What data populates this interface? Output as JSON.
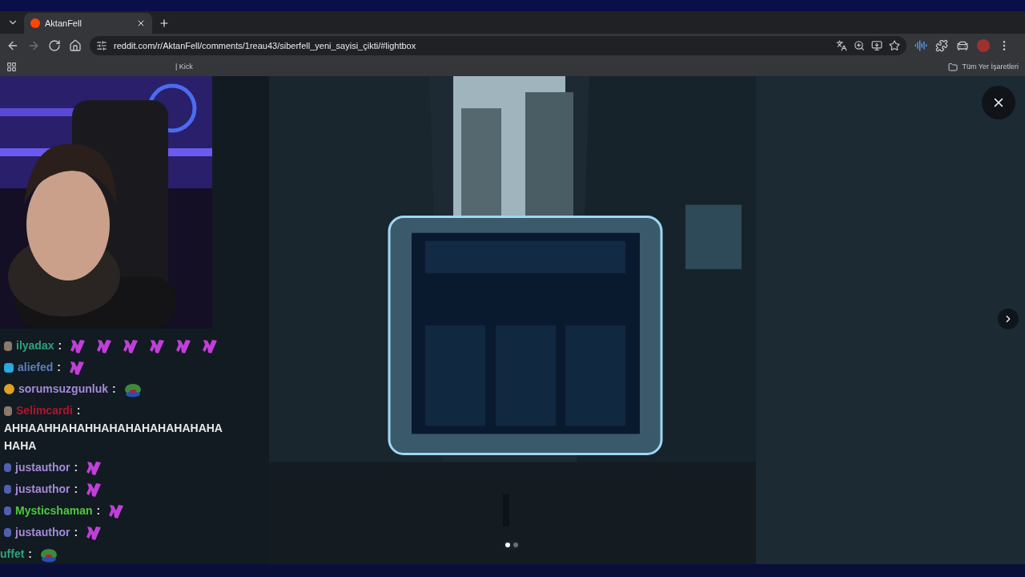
{
  "browser": {
    "tabs": [
      {
        "title": "AktanFell",
        "selected": true
      }
    ],
    "address": "reddit.com/r/AktanFell/comments/1reau43/siberfell_yeni_sayisi_çikti/#lightbox",
    "bookmarks": [
      "| Kick"
    ],
    "all_bookmarks": "Tüm Yer İşaretleri"
  },
  "chat": [
    {
      "user": "ilyadax",
      "separator": ":",
      "color": "#2fa37a",
      "badge": {
        "kind": "gift"
      },
      "emotes": [
        {
          "kind": "pink"
        },
        {
          "kind": "pink"
        },
        {
          "kind": "pink"
        },
        {
          "kind": "pink"
        },
        {
          "kind": "pink"
        },
        {
          "kind": "pink"
        }
      ]
    },
    {
      "user": "aliefed",
      "separator": ":",
      "color": "#5b7fb8",
      "badge": {
        "kind": "cube"
      },
      "emotes": [
        {
          "kind": "pink"
        }
      ]
    },
    {
      "user": "sorumsuzgunluk",
      "separator": ":",
      "color": "#a58ad6",
      "badge": {
        "kind": "coin"
      },
      "emotes": [
        {
          "kind": "frog"
        }
      ]
    },
    {
      "user": "Selimcardi",
      "separator": ":",
      "color": "#b0152a",
      "badge": {
        "kind": "gift"
      },
      "message": "AHHAAHHAHAHHAHAHAHAHAHAHAHAHAHA"
    },
    {
      "user": "justauthor",
      "separator": ":",
      "color": "#a58ad6",
      "badge": {
        "kind": "bot"
      },
      "emotes": [
        {
          "kind": "pink"
        }
      ]
    },
    {
      "user": "justauthor",
      "separator": ":",
      "color": "#a58ad6",
      "badge": {
        "kind": "bot"
      },
      "emotes": [
        {
          "kind": "pink"
        }
      ]
    },
    {
      "user": "Mysticshaman",
      "separator": ":",
      "color": "#4fc83c",
      "badge": {
        "kind": "bot"
      },
      "emotes": [
        {
          "kind": "pink"
        }
      ]
    },
    {
      "user": "justauthor",
      "separator": ":",
      "color": "#a58ad6",
      "badge": {
        "kind": "bot"
      },
      "emotes": [
        {
          "kind": "pink"
        }
      ]
    },
    {
      "user": "uffet",
      "separator": ":",
      "color": "#2fa37a",
      "emotes": [
        {
          "kind": "frog"
        }
      ]
    }
  ],
  "lightbox": {
    "slides": [
      {
        "selected": true
      },
      {
        "selected": false
      }
    ]
  }
}
